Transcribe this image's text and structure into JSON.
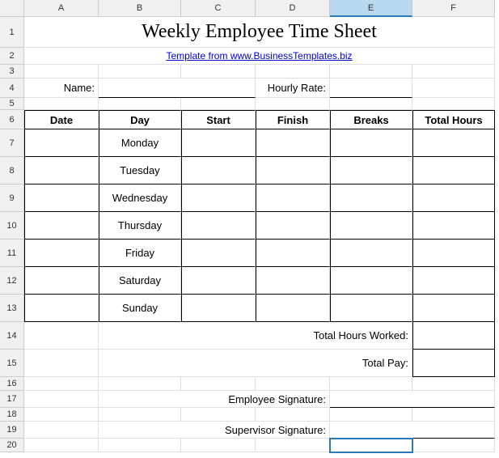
{
  "columns": [
    "A",
    "B",
    "C",
    "D",
    "E",
    "F"
  ],
  "selectedColumn": "E",
  "rows": [
    "1",
    "2",
    "3",
    "4",
    "5",
    "6",
    "7",
    "8",
    "9",
    "10",
    "11",
    "12",
    "13",
    "14",
    "15",
    "16",
    "17",
    "18",
    "19",
    "20"
  ],
  "title": "Weekly Employee Time Sheet",
  "templateLink": "Template from www.BusinessTemplates.biz",
  "labels": {
    "name": "Name:",
    "hourlyRate": "Hourly Rate:",
    "totalHoursWorked": "Total Hours Worked:",
    "totalPay": "Total Pay:",
    "employeeSignature": "Employee Signature:",
    "supervisorSignature": "Supervisor Signature:"
  },
  "headers": {
    "date": "Date",
    "day": "Day",
    "start": "Start",
    "finish": "Finish",
    "breaks": "Breaks",
    "totalHours": "Total Hours"
  },
  "days": [
    "Monday",
    "Tuesday",
    "Wednesday",
    "Thursday",
    "Friday",
    "Saturday",
    "Sunday"
  ],
  "inputs": {
    "name": "",
    "hourlyRate": "",
    "totalHoursWorked": "",
    "totalPay": ""
  }
}
